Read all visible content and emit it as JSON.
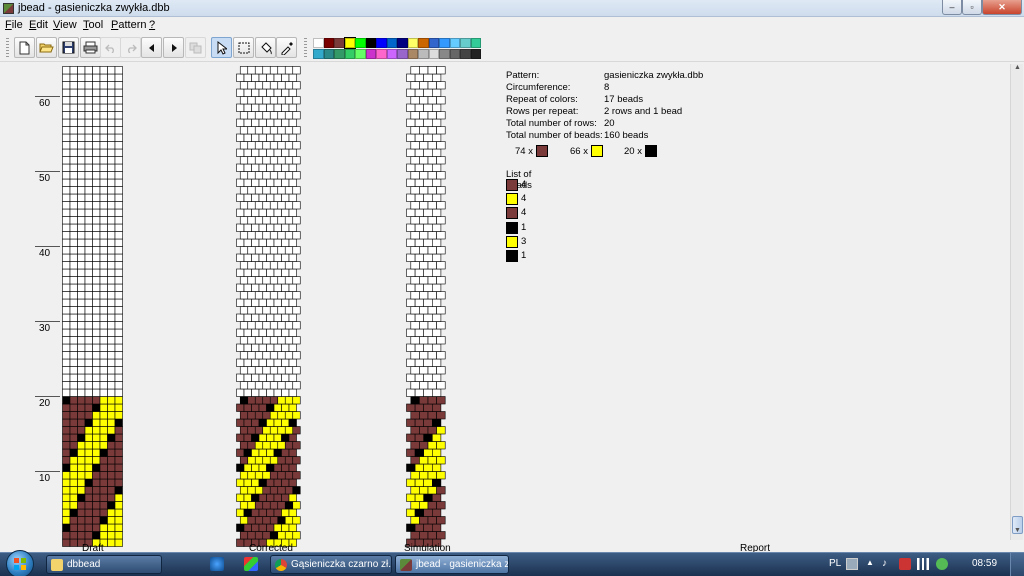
{
  "window": {
    "title": "jbead - gasieniczka zwykła.dbb",
    "minimize": "–",
    "maximize": "▫",
    "close": "✕"
  },
  "menu": [
    {
      "label": "File",
      "ul": "F",
      "rest": "ile"
    },
    {
      "label": "Edit",
      "ul": "E",
      "rest": "dit"
    },
    {
      "label": "View",
      "ul": "V",
      "rest": "iew"
    },
    {
      "label": "Tool",
      "ul": "T",
      "rest": "ool"
    },
    {
      "label": "Pattern",
      "ul": "P",
      "rest": "attern"
    },
    {
      "label": "?",
      "ul": "?",
      "rest": ""
    }
  ],
  "palette": [
    "#ffffff",
    "#7b0000",
    "#7b3a3a",
    "#ffff00",
    "#00ff00",
    "#000000",
    "#0000ff",
    "#0066cc",
    "#000080",
    "#ffff66",
    "#cc6600",
    "#3366cc",
    "#3399ff",
    "#66ccff",
    "#66cccc",
    "#33cc99",
    "#33aacc",
    "#2a8a8a",
    "#339966",
    "#33cc66",
    "#66ff66",
    "#cc33cc",
    "#ff66cc",
    "#cc66ff",
    "#9966cc",
    "#aa8866",
    "#bbbbbb",
    "#dddddd",
    "#888888",
    "#666666",
    "#444444",
    "#222222"
  ],
  "colors": {
    "brown": "#7b3a3a",
    "yellow": "#ffff00",
    "black": "#000000",
    "white": "#ffffff"
  },
  "ruler": {
    "labels": [
      "10",
      "20",
      "30",
      "40",
      "50",
      "60"
    ]
  },
  "views": {
    "draft": "Draft",
    "corrected": "Corrected",
    "simulation": "Simulation",
    "report": "Report"
  },
  "report": {
    "rows": [
      {
        "key": "Pattern:",
        "value": "gasieniczka zwykła.dbb"
      },
      {
        "key": "Circumference:",
        "value": "8"
      },
      {
        "key": "Repeat of colors:",
        "value": "17 beads"
      },
      {
        "key": "Rows per repeat:",
        "value": "2 rows and 1 bead"
      },
      {
        "key": "Total number of rows:",
        "value": "20"
      },
      {
        "key": "Total number of beads:",
        "value": "160 beads"
      }
    ],
    "counts": [
      {
        "label": "74 x",
        "color": "brown"
      },
      {
        "label": "66 x",
        "color": "yellow"
      },
      {
        "label": "20 x",
        "color": "black"
      }
    ],
    "list_title": "List of beads",
    "list": [
      {
        "color": "brown",
        "count": "4"
      },
      {
        "color": "yellow",
        "count": "4"
      },
      {
        "color": "brown",
        "count": "4"
      },
      {
        "color": "black",
        "count": "1"
      },
      {
        "color": "yellow",
        "count": "3"
      },
      {
        "color": "black",
        "count": "1"
      }
    ]
  },
  "pattern": {
    "circumference": 8,
    "filled_rows": 20,
    "visible_rows": 64,
    "sequence": [
      {
        "color": "brown",
        "count": 4
      },
      {
        "color": "yellow",
        "count": 4
      },
      {
        "color": "brown",
        "count": 4
      },
      {
        "color": "black",
        "count": 1
      },
      {
        "color": "yellow",
        "count": 3
      },
      {
        "color": "black",
        "count": 1
      }
    ]
  },
  "taskbar": {
    "tasks": [
      {
        "label": "dbbead",
        "icon": "folder-icon",
        "active": false
      },
      {
        "label": "Gąsieniczka czarno zł...",
        "icon": "chrome-icon",
        "active": false
      },
      {
        "label": "jbead - gasieniczka z...",
        "icon": "jbead-icon",
        "active": true
      }
    ],
    "language": "PL",
    "clock": "08:59"
  }
}
